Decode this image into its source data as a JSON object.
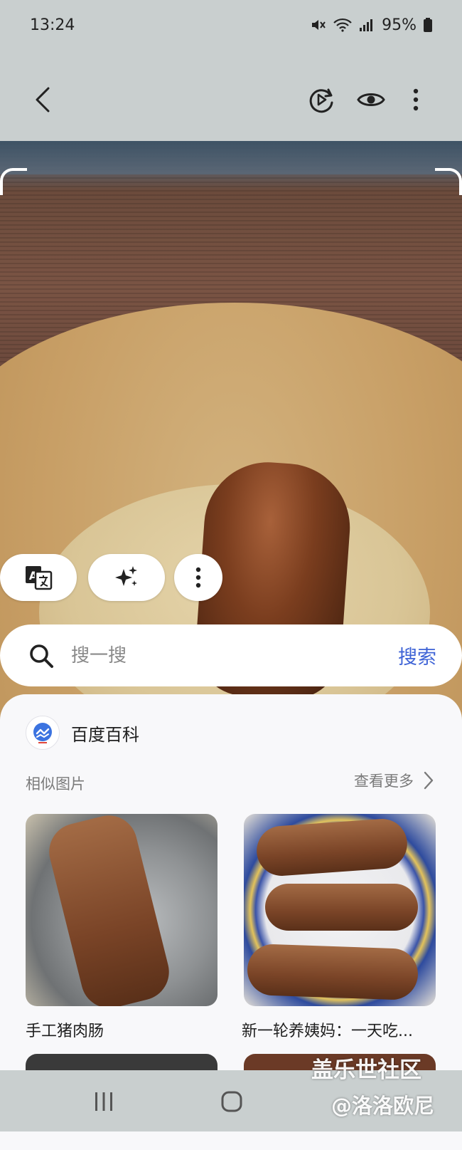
{
  "status_bar": {
    "time": "13:24",
    "battery": "95%"
  },
  "top_bar": {
    "icons": [
      "back-arrow-icon",
      "live-replay-icon",
      "eye-icon",
      "more-vertical-icon"
    ]
  },
  "actions": {
    "translate_icon": "translate-icon",
    "ai_icon": "sparkle-icon",
    "more_icon": "more-vertical-icon"
  },
  "search": {
    "placeholder": "搜一搜",
    "button_label": "搜索"
  },
  "results": {
    "source_name": "百度百科",
    "section_title": "相似图片",
    "see_more_label": "查看更多",
    "items": [
      {
        "caption": "手工猪肉肠"
      },
      {
        "caption": "新一轮养姨妈：一天吃..."
      }
    ]
  },
  "watermark": {
    "line1": "盖乐世社区",
    "line2": "@洛洛欧尼"
  },
  "colors": {
    "accent": "#3e63d6",
    "bar_bg": "#c9cfcf",
    "sheet_bg": "#f8f8fa"
  }
}
